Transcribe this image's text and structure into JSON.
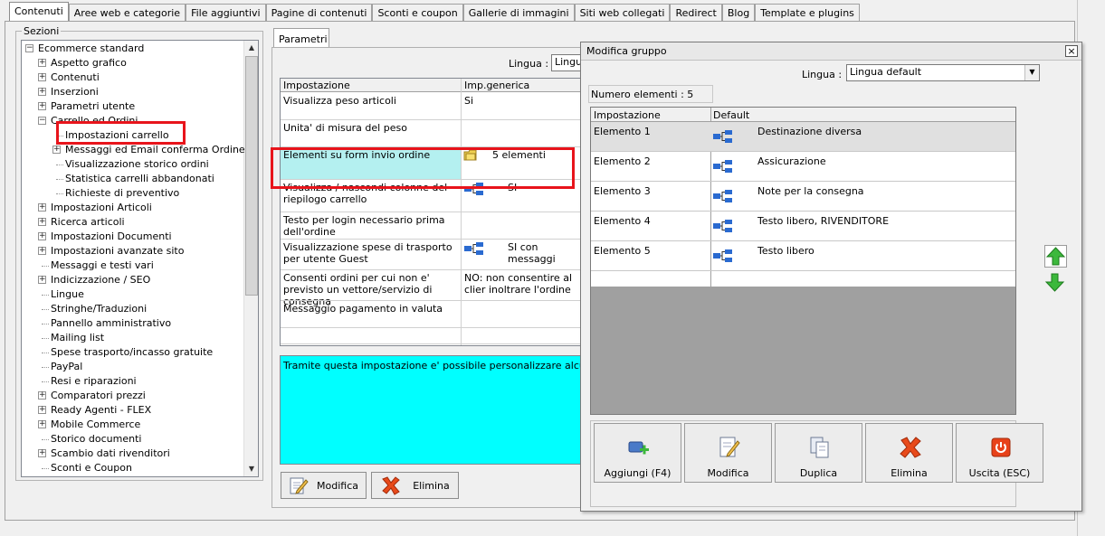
{
  "top_tabs": [
    "Contenuti",
    "Aree web e categorie",
    "File aggiuntivi",
    "Pagine di contenuti",
    "Sconti e coupon",
    "Gallerie di immagini",
    "Siti web collegati",
    "Redirect",
    "Blog",
    "Template e plugins"
  ],
  "sections": {
    "label": "Sezioni",
    "tree": [
      {
        "label": "Ecommerce standard",
        "level": 0,
        "exp": "minus"
      },
      {
        "label": "Aspetto grafico",
        "level": 1,
        "exp": "plus"
      },
      {
        "label": "Contenuti",
        "level": 1,
        "exp": "plus"
      },
      {
        "label": "Inserzioni",
        "level": 1,
        "exp": "plus"
      },
      {
        "label": "Parametri utente",
        "level": 1,
        "exp": "plus"
      },
      {
        "label": "Carrello ed Ordini",
        "level": 1,
        "exp": "minus"
      },
      {
        "label": "Impostazioni carrello",
        "level": 2,
        "exp": "none"
      },
      {
        "label": "Messaggi ed Email conferma Ordine",
        "level": 2,
        "exp": "plus"
      },
      {
        "label": "Visualizzazione storico ordini",
        "level": 2,
        "exp": "none"
      },
      {
        "label": "Statistica carrelli abbandonati",
        "level": 2,
        "exp": "none"
      },
      {
        "label": "Richieste di preventivo",
        "level": 2,
        "exp": "none"
      },
      {
        "label": "Impostazioni Articoli",
        "level": 1,
        "exp": "plus"
      },
      {
        "label": "Ricerca articoli",
        "level": 1,
        "exp": "plus"
      },
      {
        "label": "Impostazioni Documenti",
        "level": 1,
        "exp": "plus"
      },
      {
        "label": "Impostazioni avanzate sito",
        "level": 1,
        "exp": "plus"
      },
      {
        "label": "Messaggi e testi vari",
        "level": 1,
        "exp": "none"
      },
      {
        "label": "Indicizzazione / SEO",
        "level": 1,
        "exp": "plus"
      },
      {
        "label": "Lingue",
        "level": 1,
        "exp": "none"
      },
      {
        "label": "Stringhe/Traduzioni",
        "level": 1,
        "exp": "none"
      },
      {
        "label": "Pannello amministrativo",
        "level": 1,
        "exp": "none"
      },
      {
        "label": "Mailing list",
        "level": 1,
        "exp": "none"
      },
      {
        "label": "Spese trasporto/incasso gratuite",
        "level": 1,
        "exp": "none"
      },
      {
        "label": "PayPal",
        "level": 1,
        "exp": "none"
      },
      {
        "label": "Resi e riparazioni",
        "level": 1,
        "exp": "none"
      },
      {
        "label": "Comparatori prezzi",
        "level": 1,
        "exp": "plus"
      },
      {
        "label": "Ready Agenti - FLEX",
        "level": 1,
        "exp": "plus"
      },
      {
        "label": "Mobile Commerce",
        "level": 1,
        "exp": "plus"
      },
      {
        "label": "Storico documenti",
        "level": 1,
        "exp": "none"
      },
      {
        "label": "Scambio dati rivenditori",
        "level": 1,
        "exp": "plus"
      },
      {
        "label": "Sconti e Coupon",
        "level": 1,
        "exp": "none"
      }
    ]
  },
  "params": {
    "tab": "Parametri",
    "lingua_label": "Lingua :",
    "lingua_value": "Lingu",
    "col_setting": "Impostazione",
    "col_generic": "Imp.generica",
    "rows": [
      {
        "setting": "Visualizza peso articoli",
        "value": "Si",
        "icon": "none"
      },
      {
        "setting": "Unita' di misura del peso",
        "value": "",
        "icon": "none"
      },
      {
        "setting": "Elementi su form invio ordine",
        "value": "5 elementi",
        "icon": "folder"
      },
      {
        "setting": "Visualizza / nascondi colonne del riepilogo carrello",
        "value": "SI",
        "icon": "tree"
      },
      {
        "setting": "Testo per login necessario prima dell'ordine",
        "value": "",
        "icon": "none"
      },
      {
        "setting": "Visualizzazione spese di trasporto per utente Guest",
        "value": "SI con messaggi",
        "icon": "tree"
      },
      {
        "setting": "Consenti ordini per cui non e' previsto un vettore/servizio di consegna",
        "value": "NO: non consentire al clier inoltrare l'ordine",
        "icon": "none"
      },
      {
        "setting": "Messaggio pagamento in valuta",
        "value": "",
        "icon": "none"
      }
    ],
    "description": "Tramite questa impostazione e' possibile personalizzare alcuni elemen",
    "btn_modifica": "Modifica",
    "btn_elimina": "Elimina"
  },
  "dialog": {
    "title": "Modifica gruppo",
    "close": "×",
    "lingua_label": "Lingua :",
    "lingua_value": "Lingua default",
    "count": "Numero elementi : 5",
    "col_setting": "Impostazione",
    "col_default": "Default",
    "rows": [
      {
        "setting": "Elemento 1",
        "value": "Destinazione diversa"
      },
      {
        "setting": "Elemento 2",
        "value": "Assicurazione"
      },
      {
        "setting": "Elemento 3",
        "value": "Note per la consegna"
      },
      {
        "setting": "Elemento 4",
        "value": "Testo libero, RIVENDITORE"
      },
      {
        "setting": "Elemento 5",
        "value": "Testo libero"
      }
    ],
    "buttons": {
      "add": "Aggiungi (F4)",
      "edit": "Modifica",
      "duplicate": "Duplica",
      "delete": "Elimina",
      "exit": "Uscita (ESC)"
    }
  },
  "colors": {
    "highlight_red": "#e8141b",
    "selected_cell": "#b4f0f0",
    "description_bg": "#00ffff",
    "arrow_green": "#3cb83c"
  }
}
